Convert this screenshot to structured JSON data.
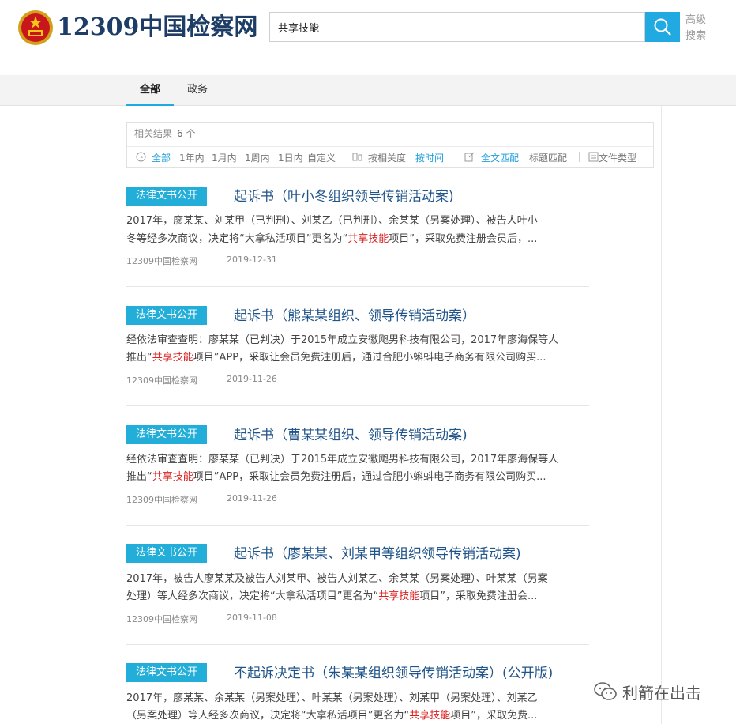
{
  "header": {
    "logo_text": "12309中国检察网",
    "search_value": "共享技能",
    "advanced_line1": "高级",
    "advanced_line2": "搜索"
  },
  "tabs": [
    {
      "label": "全部",
      "active": true
    },
    {
      "label": "政务",
      "active": false
    }
  ],
  "filters": {
    "count_label": "相关结果",
    "count": "6",
    "count_unit": "个",
    "time_options": [
      "全部",
      "1年内",
      "1月内",
      "1周内",
      "1日内",
      "自定义"
    ],
    "sort_options": [
      "按相关度",
      "按时间"
    ],
    "match_options": [
      "全文匹配",
      "标题匹配"
    ],
    "type_label": "文件类型"
  },
  "results": [
    {
      "badge": "法律文书公开",
      "title": "起诉书（叶小冬组织领导传销活动案)",
      "line1": "2017年，廖某某、刘某甲（已判刑）、刘某乙（已判刑）、余某某（另案处理）、被告人叶小",
      "line2_pre": "冬等经多次商议，决定将“大拿私活项目”更名为“",
      "line2_hl": "共享技能",
      "line2_post": "项目”，采取免费注册会员后，...",
      "source": "12309中国检察网",
      "date": "2019-12-31"
    },
    {
      "badge": "法律文书公开",
      "title": "起诉书（熊某某组织、领导传销活动案）",
      "line1": "经依法审查查明：廖某某（已判决）于2015年成立安徽飑男科技有限公司，2017年廖海保等人",
      "line2_pre": "推出“",
      "line2_hl": "共享技能",
      "line2_post": "项目”APP，采取让会员免费注册后，通过合肥小蝌蚪电子商务有限公司购买...",
      "source": "12309中国检察网",
      "date": "2019-11-26"
    },
    {
      "badge": "法律文书公开",
      "title": "起诉书（曹某某组织、领导传销活动案)",
      "line1": "经依法审查查明：廖某某（已判决）于2015年成立安徽飑男科技有限公司，2017年廖海保等人",
      "line2_pre": "推出“",
      "line2_hl": "共享技能",
      "line2_post": "项目”APP，采取让会员免费注册后，通过合肥小蝌蚪电子商务有限公司购买...",
      "source": "12309中国检察网",
      "date": "2019-11-26"
    },
    {
      "badge": "法律文书公开",
      "title": "起诉书（廖某某、刘某甲等组织领导传销活动案)",
      "line1": "2017年，被告人廖某某及被告人刘某甲、被告人刘某乙、余某某（另案处理）、叶某某（另案",
      "line2_pre": "处理）等人经多次商议，决定将“大拿私活项目”更名为“",
      "line2_hl": "共享技能",
      "line2_post": "项目”，采取免费注册会...",
      "source": "12309中国检察网",
      "date": "2019-11-08"
    },
    {
      "badge": "法律文书公开",
      "title": "不起诉决定书（朱某某组织领导传销活动案）(公开版)",
      "line1": "2017年，廖某某、余某某（另案处理）、叶某某（另案处理）、刘某甲（另案处理）、刘某乙",
      "line2_pre": "（另案处理）等人经多次商议，决定将“大拿私活项目”更名为“",
      "line2_hl": "共享技能",
      "line2_post": "项目”，采取免费...",
      "source": "",
      "date": ""
    }
  ],
  "watermark": "利箭在出击",
  "colors": {
    "accent": "#21a9e1",
    "badge": "#22aed8",
    "title": "#21558a",
    "highlight": "#d92020"
  }
}
